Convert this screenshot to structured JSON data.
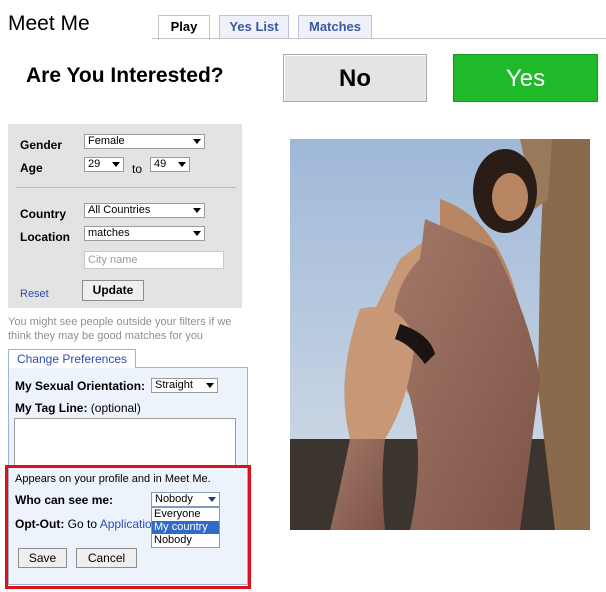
{
  "header": {
    "title": "Meet Me",
    "tabs": [
      {
        "label": "Play",
        "active": true
      },
      {
        "label": "Yes List",
        "active": false
      },
      {
        "label": "Matches",
        "active": false
      }
    ]
  },
  "question": {
    "text": "Are You Interested?",
    "no_label": "No",
    "yes_label": "Yes"
  },
  "filters": {
    "gender_label": "Gender",
    "gender_value": "Female",
    "age_label": "Age",
    "age_from": "29",
    "age_to_label": "to",
    "age_to": "49",
    "country_label": "Country",
    "country_value": "All Countries",
    "location_label": "Location",
    "location_value": "matches",
    "city_placeholder": "City name",
    "reset_label": "Reset",
    "update_label": "Update",
    "note": "You might see people outside your filters if we think they may be good matches for you"
  },
  "preferences": {
    "tab_label": "Change Preferences",
    "orientation_label": "My Sexual Orientation:",
    "orientation_value": "Straight",
    "tagline_label": "My Tag Line:",
    "tagline_optional": "(optional)",
    "profile_note": "Appears on your profile and in Meet Me.",
    "who_label": "Who can see me:",
    "who_value": "Nobody",
    "who_options": [
      "Everyone",
      "My country",
      "Nobody"
    ],
    "optout_label": "Opt-Out:",
    "optout_text": "Go to",
    "optout_link": "Applicatio",
    "save_label": "Save",
    "cancel_label": "Cancel"
  },
  "colors": {
    "yes_button": "#1fba2a",
    "highlight_border": "#e0101b",
    "link": "#2a4cb5"
  }
}
